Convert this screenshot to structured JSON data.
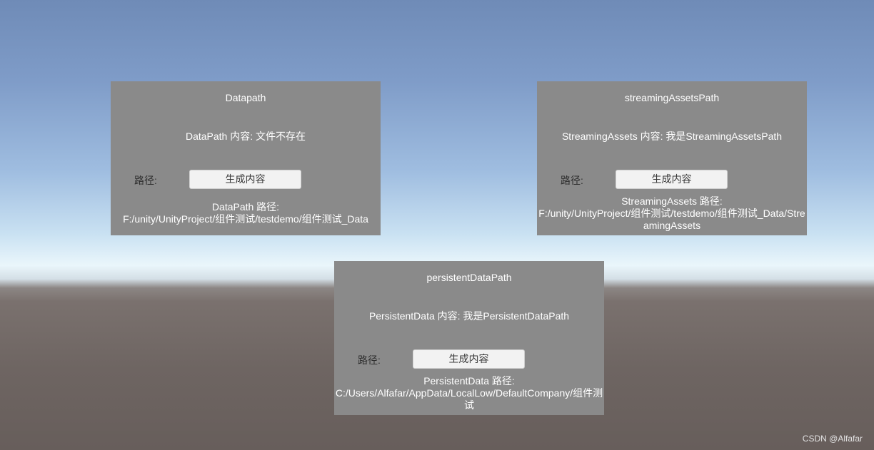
{
  "panels": {
    "datapath": {
      "title": "Datapath",
      "content": "DataPath 内容: 文件不存在",
      "path_label": "路径:",
      "button_label": "生成内容",
      "path_line1": "DataPath 路径:",
      "path_line2": "F:/unity/UnityProject/组件测试/testdemo/组件测试_Data"
    },
    "streaming": {
      "title": "streamingAssetsPath",
      "content": "StreamingAssets 内容: 我是StreamingAssetsPath",
      "path_label": "路径:",
      "button_label": "生成内容",
      "path_line1": "StreamingAssets 路径:",
      "path_line2": "F:/unity/UnityProject/组件测试/testdemo/组件测试_Data/StreamingAssets"
    },
    "persistent": {
      "title": "persistentDataPath",
      "content": "PersistentData 内容: 我是PersistentDataPath",
      "path_label": "路径:",
      "button_label": "生成内容",
      "path_line1": "PersistentData 路径:",
      "path_line2": "C:/Users/Alfafar/AppData/LocalLow/DefaultCompany/组件测试"
    }
  },
  "watermark": "CSDN @Alfafar"
}
